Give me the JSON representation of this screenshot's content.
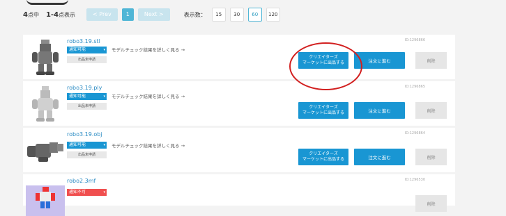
{
  "pagination": {
    "total_count": "4",
    "total_unit": "点中",
    "range": "1-4",
    "range_unit": "点表示",
    "prev_label": "< Prev",
    "current_page": "1",
    "next_label": "Next >",
    "per_page_label": "表示数：",
    "per_page_options": [
      "15",
      "30",
      "60",
      "120"
    ],
    "per_page_selected": "60"
  },
  "items": [
    {
      "filename": "robo3.19.stl",
      "badge": "通知可能",
      "status": "出品未申請",
      "check_link": "モデルチェック結果を詳しく見る →",
      "id": "ID:1296866",
      "creators_button": [
        "クリエイターズ",
        "マーケットに出品する"
      ],
      "order_button": "注文に進む",
      "delete_button": "削除",
      "thumb_icon": "robot-model-icon"
    },
    {
      "filename": "robo3.19.ply",
      "badge": "通知可能",
      "status": "出品未申請",
      "check_link": "モデルチェック結果を詳しく見る →",
      "id": "ID:1296865",
      "creators_button": [
        "クリエイターズ",
        "マーケットに出品する"
      ],
      "order_button": "注文に進む",
      "delete_button": "削除",
      "thumb_icon": "robot-model-icon"
    },
    {
      "filename": "robo3.19.obj",
      "badge": "通知可能",
      "status": "出品未申請",
      "check_link": "モデルチェック結果を詳しく見る →",
      "id": "ID:1296864",
      "creators_button": [
        "クリエイターズ",
        "マーケットに出品する"
      ],
      "order_button": "注文に進む",
      "delete_button": "削除",
      "thumb_icon": "robot-lying-model-icon"
    },
    {
      "filename": "robo2.3mf",
      "badge": "通知不可",
      "id": "ID:1296530",
      "delete_button": "削除",
      "thumb_icon": "color-robot-model-icon"
    }
  ],
  "colors": {
    "accent": "#1996d3",
    "pager_active": "#50b6d6",
    "error_badge": "#f04f4f",
    "highlight_circle": "#d22020"
  }
}
